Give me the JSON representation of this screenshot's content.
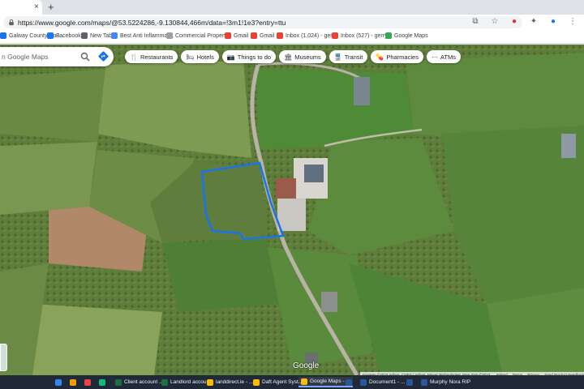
{
  "browser": {
    "url": "https://www.google.com/maps/@53.5224286,-9.130844,466m/data=!3m1!1e3?entry=ttu",
    "new_tab_symbol": "+",
    "close_symbol": "×"
  },
  "bookmarks": [
    {
      "label": "Galway County Cou...",
      "color": "#1a73e8"
    },
    {
      "label": "Facebook",
      "color": "#1877f2"
    },
    {
      "label": "New Tab",
      "color": "#5f6368"
    },
    {
      "label": "Best Anti Inflammat...",
      "color": "#4285f4"
    },
    {
      "label": "Commercial Propert...",
      "color": "#9aa0a6"
    },
    {
      "label": "Gmail",
      "color": "#ea4335"
    },
    {
      "label": "Gmail",
      "color": "#ea4335"
    },
    {
      "label": "Inbox (1,024) - gerr...",
      "color": "#ea4335"
    },
    {
      "label": "Inbox (527) - gerry...",
      "color": "#ea4335"
    },
    {
      "label": "Google Maps",
      "color": "#34a853"
    }
  ],
  "search": {
    "placeholder": "n Google Maps"
  },
  "chips": [
    {
      "label": "Restaurants",
      "icon": "fork-knife-icon",
      "glyph": "🍴"
    },
    {
      "label": "Hotels",
      "icon": "bed-icon",
      "glyph": "🛏"
    },
    {
      "label": "Things to do",
      "icon": "camera-icon",
      "glyph": "📷"
    },
    {
      "label": "Museums",
      "icon": "museum-icon",
      "glyph": "🏛"
    },
    {
      "label": "Transit",
      "icon": "train-icon",
      "glyph": "🚆"
    },
    {
      "label": "Pharmacies",
      "icon": "pharmacy-icon",
      "glyph": "💊"
    },
    {
      "label": "ATMs",
      "icon": "more-icon",
      "glyph": "⋯"
    }
  ],
  "map": {
    "logo": "Google",
    "attribution": "Imagery ©2023 Airbus, CNES / Airbus, Maxar Technologies, Map data ©2023",
    "links": [
      "Ireland",
      "Terms",
      "Privacy",
      "Send Product Feedback"
    ],
    "boundary_color": "#1a73e8"
  },
  "taskbar": [
    {
      "label": "",
      "color": "#3b82f6"
    },
    {
      "label": "",
      "color": "#f59e0b"
    },
    {
      "label": "",
      "color": "#ef4444"
    },
    {
      "label": "",
      "color": "#10b981"
    },
    {
      "label": "Client account ...",
      "color": "#1d6f42"
    },
    {
      "label": "Landlord accou...",
      "color": "#1d6f42"
    },
    {
      "label": "landdirect.ie - ...",
      "color": "#fbbc04"
    },
    {
      "label": "Daft Agent Syst...",
      "color": "#fbbc04"
    },
    {
      "label": "Google Maps - ...",
      "color": "#fbbc04"
    },
    {
      "label": "",
      "color": "#2b579a"
    },
    {
      "label": "Document1 - ...",
      "color": "#2b579a"
    },
    {
      "label": "",
      "color": "#2b579a"
    },
    {
      "label": "Murphy Nora RIP",
      "color": "#2b579a"
    }
  ]
}
